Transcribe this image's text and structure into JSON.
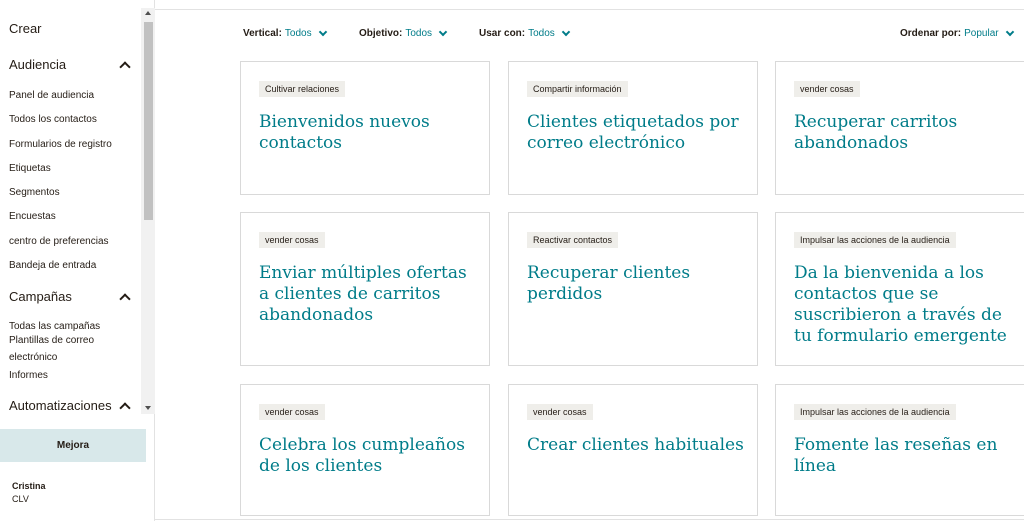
{
  "sidebar": {
    "create": "Crear",
    "audience": {
      "title": "Audiencia",
      "items": [
        "Panel de audiencia",
        "Todos los contactos",
        "Formularios de registro",
        "Etiquetas",
        "Segmentos",
        "Encuestas",
        "centro de preferencias",
        "Bandeja de entrada"
      ]
    },
    "campaigns": {
      "title": "Campañas",
      "items": [
        "Todas las campañas",
        "Plantillas de correo electrónico",
        "Informes"
      ]
    },
    "automations": {
      "title": "Automatizaciones"
    },
    "upgrade_label": "Mejora",
    "user": {
      "name": "Cristina",
      "org": "CLV"
    }
  },
  "filters": {
    "vertical": {
      "label": "Vertical:",
      "value": "Todos"
    },
    "objective": {
      "label": "Objetivo:",
      "value": "Todos"
    },
    "use_with": {
      "label": "Usar con:",
      "value": "Todos"
    },
    "sort": {
      "label": "Ordenar por:",
      "value": "Popular"
    }
  },
  "cards": [
    {
      "tag": "Cultivar relaciones",
      "title": "Bienvenidos nuevos contactos"
    },
    {
      "tag": "Compartir información",
      "title": "Clientes etiquetados por correo electrónico"
    },
    {
      "tag": "vender cosas",
      "title": "Recuperar carritos abandonados"
    },
    {
      "tag": "vender cosas",
      "title": "Enviar múltiples ofertas a clientes de carritos abandonados"
    },
    {
      "tag": "Reactivar contactos",
      "title": "Recuperar clientes perdidos"
    },
    {
      "tag": "Impulsar las acciones de la audiencia",
      "title": "Da la bienvenida a los contactos que se suscribieron a través de tu formulario emergente"
    },
    {
      "tag": "vender cosas",
      "title": "Celebra los cumpleaños de los clientes"
    },
    {
      "tag": "vender cosas",
      "title": "Crear clientes habituales"
    },
    {
      "tag": "Impulsar las acciones de la audiencia",
      "title": "Fomente las reseñas en línea"
    }
  ],
  "colors": {
    "accent": "#007c89",
    "upgrade_bg": "#d8e8ea",
    "tag_bg": "#efeeea"
  }
}
